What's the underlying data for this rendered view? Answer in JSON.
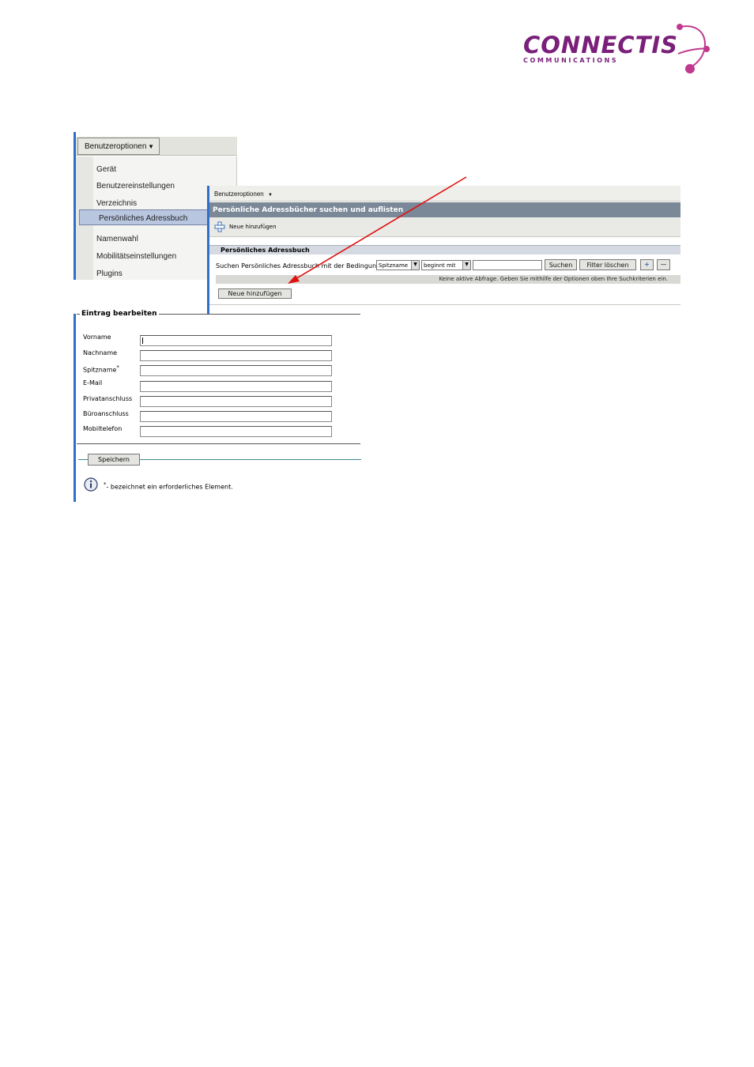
{
  "logo": {
    "word": "CONNECTIS",
    "subtitle": "COMMUNICATIONS",
    "color": "#7a1f7a",
    "accent": "#c0398f"
  },
  "menu_screen": {
    "dropdown_label": "Benutzeroptionen",
    "items": [
      {
        "label": "Gerät"
      },
      {
        "label": "Benutzereinstellungen"
      },
      {
        "label": "Verzeichnis"
      },
      {
        "label": "Persönliches Adressbuch",
        "active": true
      },
      {
        "label": "Namenwahl"
      },
      {
        "label": "Mobilitätseinstellungen"
      },
      {
        "label": "Plugins"
      }
    ]
  },
  "list_screen": {
    "top_menu": "Benutzeroptionen",
    "title": "Persönliche Adressbücher suchen und auflisten",
    "toolbar_add": "Neue hinzufügen",
    "section": "Persönliches Adressbuch",
    "search_label": "Suchen Persönliches Adressbuch mit der Bedingung:",
    "field_select": "Spitzname",
    "condition_select": "beginnt mit",
    "search_button": "Suchen",
    "clear_button": "Filter löschen",
    "add_row_button": "+",
    "remove_row_button": "—",
    "hint": "Keine aktive Abfrage. Geben Sie mithilfe der Optionen oben Ihre Suchkriterien ein.",
    "add_button": "Neue hinzufügen"
  },
  "edit_screen": {
    "legend": "Eintrag bearbeiten",
    "fields": [
      {
        "label": "Vorname"
      },
      {
        "label": "Nachname"
      },
      {
        "label": "Spitzname",
        "required_mark": "*"
      },
      {
        "label": "E-Mail"
      },
      {
        "label": "Privatanschluss"
      },
      {
        "label": "Büroanschluss"
      },
      {
        "label": "Mobiltelefon"
      }
    ],
    "save_button": "Speichern",
    "required_note_mark": "*",
    "required_note": "- bezeichnet ein erforderliches Element."
  },
  "annotation": {
    "arrow_color": "#e01010"
  }
}
